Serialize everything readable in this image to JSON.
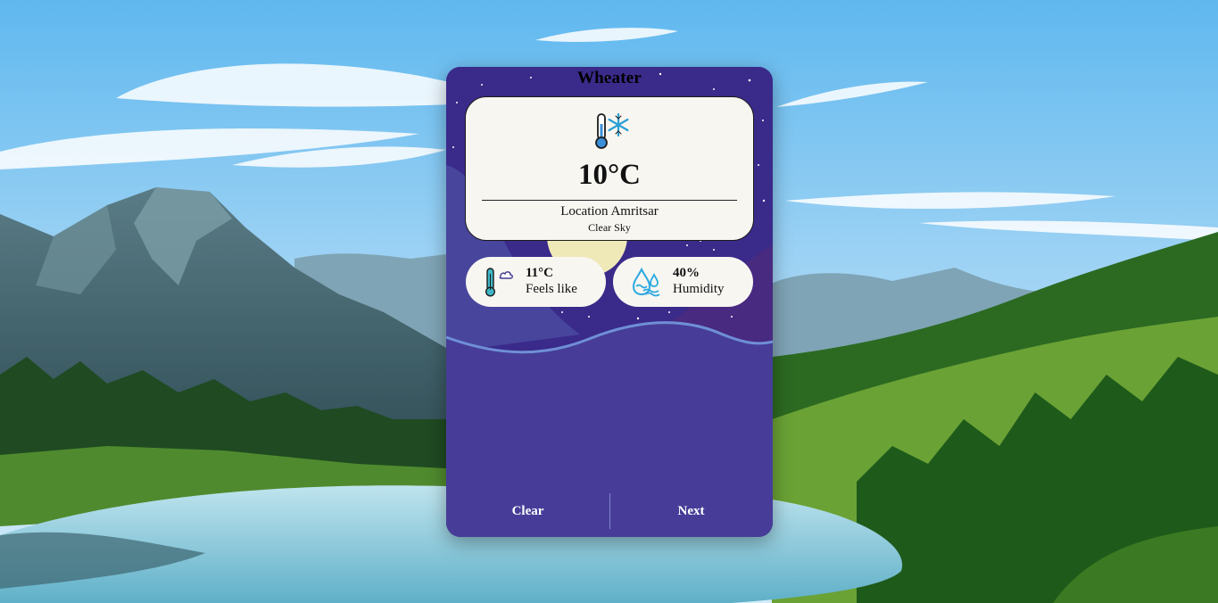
{
  "app": {
    "title": "Wheater"
  },
  "current": {
    "temperature": "10°C",
    "location": "Location Amritsar",
    "condition": "Clear Sky",
    "icon": "thermometer-snowflake-icon"
  },
  "stats": {
    "feels_like": {
      "value": "11°C",
      "label": "Feels like",
      "icon": "thermometer-cloud-icon"
    },
    "humidity": {
      "value": "40%",
      "label": "Humidity",
      "icon": "water-drop-icon"
    }
  },
  "buttons": {
    "clear": "Clear",
    "next": "Next"
  },
  "colors": {
    "card_purple": "#3f3a8e",
    "night_sky": "#3a2a8a",
    "panel": "#f8f6f1",
    "wave_line": "#6f8fd6",
    "button_text": "#ffffff"
  }
}
